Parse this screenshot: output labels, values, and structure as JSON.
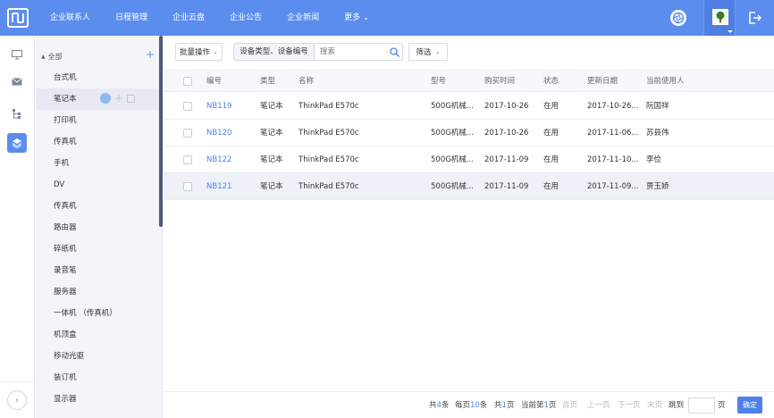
{
  "top_nav": {
    "items": [
      "企业联系人",
      "日程管理",
      "企业云盘",
      "企业公告",
      "企业新闻",
      "更多"
    ]
  },
  "sidebar": {
    "root_label": "全部",
    "items": [
      "台式机",
      "笔记本",
      "打印机",
      "传真机",
      "手机",
      "DV",
      "传真机",
      "路由器",
      "碎纸机",
      "录音笔",
      "服务器",
      "一体机 （传真机）",
      "机顶盒",
      "移动光驱",
      "装订机",
      "显示器"
    ]
  },
  "toolbar": {
    "batch_label": "批量操作",
    "search_type": "设备类型、设备编号",
    "search_placeholder": "搜索",
    "filter_label": "筛选"
  },
  "table": {
    "columns": [
      "编号",
      "类型",
      "名称",
      "型号",
      "购买时间",
      "状态",
      "更新日期",
      "当前使用人"
    ],
    "rows": [
      [
        "NB119",
        "笔记本",
        "ThinkPad E570c",
        "500G机械...",
        "2017-10-26",
        "在用",
        "2017-10-26...",
        "阮国祥"
      ],
      [
        "NB120",
        "笔记本",
        "ThinkPad E570c",
        "500G机械...",
        "2017-10-26",
        "在用",
        "2017-11-06...",
        "苏县伟"
      ],
      [
        "NB122",
        "笔记本",
        "ThinkPad E570c",
        "500G机械...",
        "2017-11-09",
        "在用",
        "2017-11-10...",
        "李俭"
      ],
      [
        "NB121",
        "笔记本",
        "ThinkPad E570c",
        "500G机械...",
        "2017-11-09",
        "在用",
        "2017-11-09...",
        "贾玉娇"
      ]
    ]
  },
  "pagination": {
    "total_pre": "共",
    "total_num": "4",
    "total_suf": "条",
    "per_pre": "每页",
    "per_num": "10",
    "per_suf": "条",
    "pages_pre": "共",
    "pages_num": "1",
    "pages_suf": "页",
    "current_pre": "当前第",
    "current_num": "1",
    "current_suf": "页",
    "first": "首页",
    "prev": "上一页",
    "next": "下一页",
    "last": "末页",
    "jump_label": "跳到",
    "page_unit": "页",
    "confirm": "确定"
  },
  "colors": {
    "primary": "#5b8def",
    "link": "#4f81e8",
    "sidebar_bg": "#f4f5f9"
  }
}
